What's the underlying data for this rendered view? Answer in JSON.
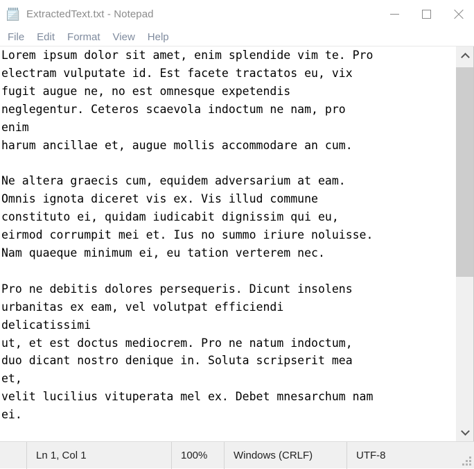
{
  "window": {
    "title": "ExtractedText.txt - Notepad",
    "app_icon": "notepad-icon",
    "controls": {
      "minimize": "minimize-icon",
      "maximize": "maximize-icon",
      "close": "close-icon"
    }
  },
  "menubar": {
    "items": [
      {
        "label": "File"
      },
      {
        "label": "Edit"
      },
      {
        "label": "Format"
      },
      {
        "label": "View"
      },
      {
        "label": "Help"
      }
    ]
  },
  "editor": {
    "content": "Lorem ipsum dolor sit amet, enim splendide vim te. Pro\nelectram vulputate id. Est facete tractatos eu, vix\nfugit augue ne, no est omnesque expetendis\nneglegentur. Ceteros scaevola indoctum ne nam, pro\nenim\nharum ancillae et, augue mollis accommodare an cum.\n\nNe altera graecis cum, equidem adversarium at eam.\nOmnis ignota diceret vis ex. Vis illud commune\nconstituto ei, quidam iudicabit dignissim qui eu,\neirmod corrumpit mei et. Ius no summo iriure noluisse.\nNam quaeque minimum ei, eu tation verterem nec.\n\nPro ne debitis dolores persequeris. Dicunt insolens\nurbanitas ex eam, vel volutpat efficiendi\ndelicatissimi\nut, et est doctus mediocrem. Pro ne natum indoctum,\nduo dicant nostro denique in. Soluta scripserit mea\net,\nvelit lucilius vituperata mel ex. Debet mnesarchum nam\nei.",
    "placeholder": ""
  },
  "scrollbar": {
    "up_arrow": "chevron-up-icon",
    "down_arrow": "chevron-down-icon",
    "thumb": "scroll-thumb"
  },
  "statusbar": {
    "cursor_position": "Ln 1, Col 1",
    "zoom": "100%",
    "line_ending": "Windows (CRLF)",
    "encoding": "UTF-8",
    "resize_grip": "resize-grip-icon"
  },
  "colors": {
    "title_text": "#8c8c8c",
    "menu_text": "#7f8b9e",
    "text_body": "#000000",
    "statusbar_bg": "#f0f0f0",
    "scroll_thumb": "#cdcdcd",
    "window_bg": "#ffffff"
  }
}
